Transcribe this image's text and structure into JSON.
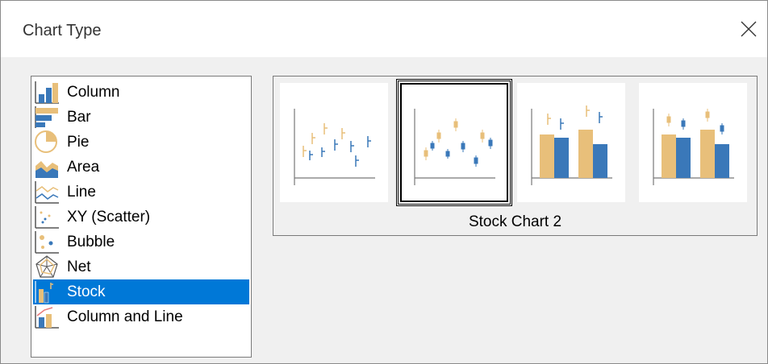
{
  "dialog": {
    "title": "Chart Type"
  },
  "chart_types": [
    {
      "label": "Column",
      "icon": "column-chart-icon"
    },
    {
      "label": "Bar",
      "icon": "bar-chart-icon"
    },
    {
      "label": "Pie",
      "icon": "pie-chart-icon"
    },
    {
      "label": "Area",
      "icon": "area-chart-icon"
    },
    {
      "label": "Line",
      "icon": "line-chart-icon"
    },
    {
      "label": "XY (Scatter)",
      "icon": "scatter-chart-icon"
    },
    {
      "label": "Bubble",
      "icon": "bubble-chart-icon"
    },
    {
      "label": "Net",
      "icon": "net-chart-icon"
    },
    {
      "label": "Stock",
      "icon": "stock-chart-icon",
      "selected": true
    },
    {
      "label": "Column and Line",
      "icon": "column-and-line-chart-icon"
    }
  ],
  "variants": {
    "selected_caption": "Stock Chart 2",
    "selected_index": 1,
    "items": [
      {
        "icon": "stock-chart-1-thumbnail"
      },
      {
        "icon": "stock-chart-2-thumbnail"
      },
      {
        "icon": "stock-chart-3-thumbnail"
      },
      {
        "icon": "stock-chart-4-thumbnail"
      }
    ]
  },
  "colors": {
    "orange": "#e8bf7a",
    "blue": "#3a78b9",
    "selection": "#0078d7"
  }
}
